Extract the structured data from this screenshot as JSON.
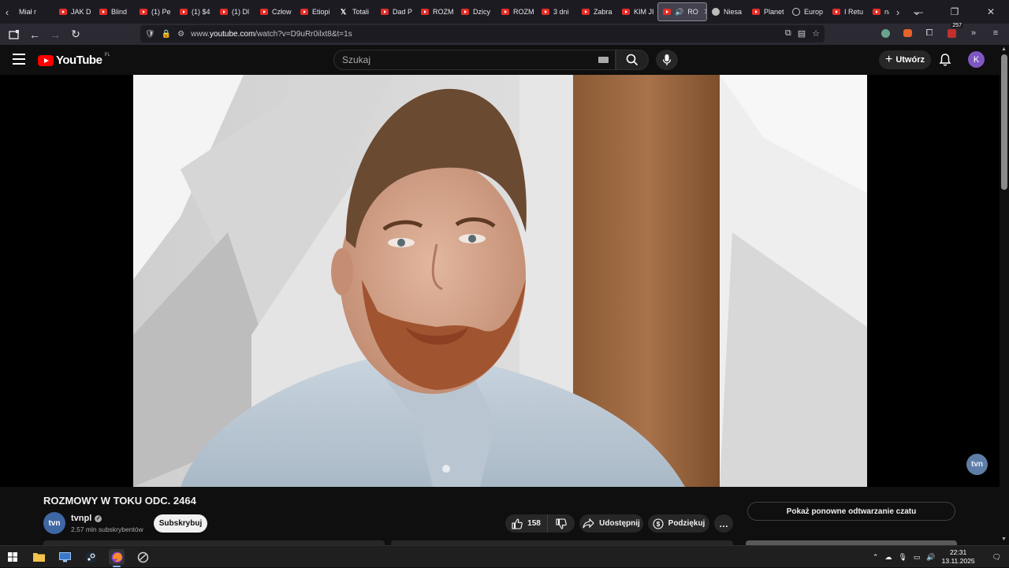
{
  "browser": {
    "tabs": [
      {
        "label": "Miał r",
        "icon": "none"
      },
      {
        "label": "JAK D",
        "icon": "youtube"
      },
      {
        "label": "Blind",
        "icon": "youtube"
      },
      {
        "label": "(1) Pe",
        "icon": "youtube"
      },
      {
        "label": "(1) $4",
        "icon": "youtube"
      },
      {
        "label": "(1) Dl",
        "icon": "youtube"
      },
      {
        "label": "Człow",
        "icon": "youtube"
      },
      {
        "label": "Etiopi",
        "icon": "youtube"
      },
      {
        "label": "Totali",
        "icon": "x"
      },
      {
        "label": "Dad P",
        "icon": "youtube"
      },
      {
        "label": "ROZM",
        "icon": "youtube"
      },
      {
        "label": "Dzicy",
        "icon": "youtube"
      },
      {
        "label": "ROZM",
        "icon": "youtube"
      },
      {
        "label": "3 dni",
        "icon": "youtube"
      },
      {
        "label": "Zabra",
        "icon": "youtube"
      },
      {
        "label": "KIM JI",
        "icon": "youtube"
      },
      {
        "label": "RO",
        "icon": "youtube",
        "active": true
      },
      {
        "label": "Niesa",
        "icon": "grey"
      },
      {
        "label": "Planet",
        "icon": "youtube"
      },
      {
        "label": "Europ",
        "icon": "globe"
      },
      {
        "label": "I Retu",
        "icon": "youtube"
      },
      {
        "label": "nasz",
        "icon": "youtube"
      }
    ],
    "url_prefix": "www.",
    "url_domain": "youtube.com",
    "url_path": "/watch?v=D9uRr0ilxt8&t=1s",
    "notification_badge": "257"
  },
  "header": {
    "logo_text": "YouTube",
    "country_code": "PL",
    "search_placeholder": "Szukaj",
    "create_label": "Utwórz",
    "avatar_letter": "K"
  },
  "player": {
    "watermark": "tvn"
  },
  "video": {
    "title": "ROZMOWY W TOKU ODC. 2464",
    "channel_name": "tvnpl",
    "channel_avatar_text": "tvn",
    "subscribers": "2,57 mln subskrybentów",
    "subscribe_label": "Subskrybuj",
    "likes": "158",
    "share_label": "Udostępnij",
    "thanks_label": "Podziękuj",
    "more_label": "…"
  },
  "sidebar": {
    "chat_replay_label": "Pokaż ponowne odtwarzanie czatu"
  },
  "taskbar": {
    "time": "22:31",
    "date": "13.11.2025"
  },
  "colors": {
    "youtube_red": "#ff0000",
    "background": "#0f0f0f",
    "avatar_purple": "#7e57c2"
  }
}
